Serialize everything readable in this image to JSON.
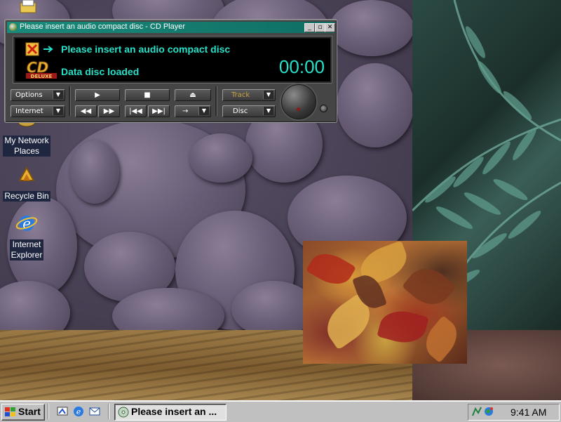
{
  "desktop": {
    "icons": [
      {
        "label": "My Network Places",
        "label_line1": "My Network",
        "label_line2": "Places"
      },
      {
        "label": "Recycle Bin"
      },
      {
        "label": "Internet Explorer",
        "label_line1": "Internet",
        "label_line2": "Explorer"
      }
    ]
  },
  "cd_player": {
    "title": "Please insert an audio compact disc - CD Player",
    "message_primary": "Please insert an audio compact disc",
    "message_secondary": "Data disc loaded",
    "time": "00:00",
    "logo_text": "DELUXE",
    "buttons": {
      "options": "Options",
      "internet": "Internet",
      "track": "Track",
      "disc": "Disc",
      "play": "▶",
      "stop": "■",
      "eject": "⏏",
      "rewind": "◀◀",
      "fast_forward": "▶▶",
      "prev_track": "|◀◀",
      "next_track": "▶▶|",
      "mode": "→"
    },
    "window_buttons": {
      "minimize": "_",
      "restore": "▫",
      "close": "✕"
    }
  },
  "taskbar": {
    "start_label": "Start",
    "task_button_label": "Please insert an ...",
    "clock": "9:41 AM"
  },
  "colors": {
    "title_bar": "#0f6f64",
    "display_text": "#27e0c8",
    "taskbar": "#c0c0c0"
  }
}
